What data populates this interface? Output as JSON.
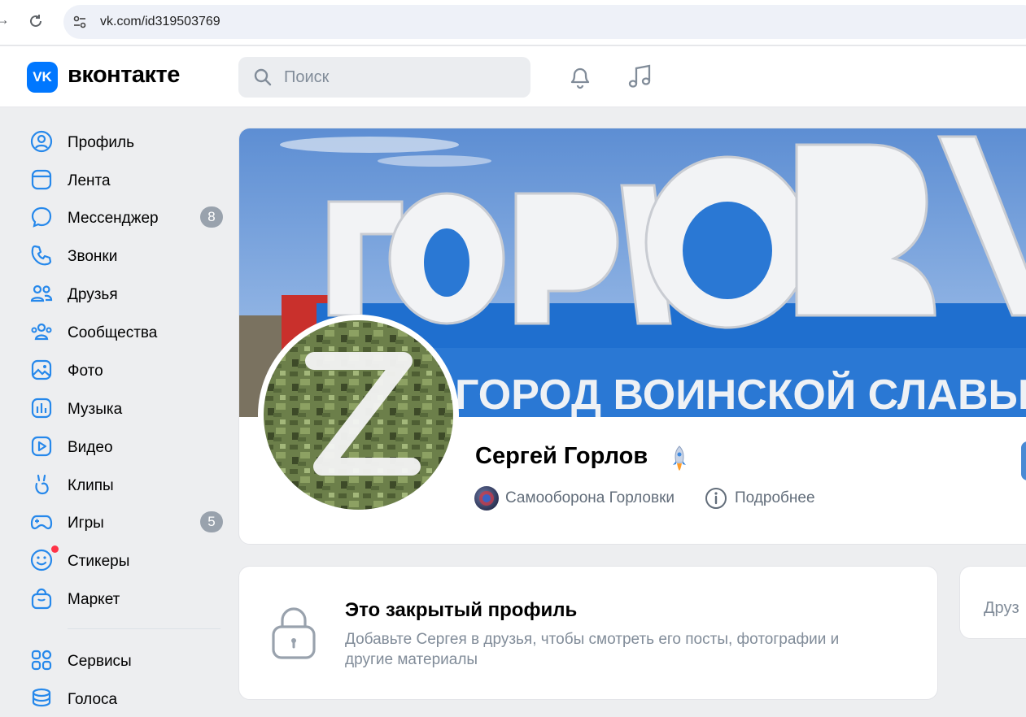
{
  "browser": {
    "url": "vk.com/id319503769"
  },
  "header": {
    "logo_mark": "VK",
    "logo_text": "вконтакте",
    "search_placeholder": "Поиск"
  },
  "sidebar": {
    "items": [
      {
        "label": "Профиль",
        "icon": "profile-icon"
      },
      {
        "label": "Лента",
        "icon": "feed-icon"
      },
      {
        "label": "Мессенджер",
        "icon": "messenger-icon",
        "badge": "8"
      },
      {
        "label": "Звонки",
        "icon": "phone-icon"
      },
      {
        "label": "Друзья",
        "icon": "friends-icon"
      },
      {
        "label": "Сообщества",
        "icon": "communities-icon"
      },
      {
        "label": "Фото",
        "icon": "photo-icon"
      },
      {
        "label": "Музыка",
        "icon": "music-icon"
      },
      {
        "label": "Видео",
        "icon": "video-icon"
      },
      {
        "label": "Клипы",
        "icon": "clips-icon"
      },
      {
        "label": "Игры",
        "icon": "games-icon",
        "badge": "5"
      },
      {
        "label": "Стикеры",
        "icon": "stickers-icon"
      },
      {
        "label": "Маркет",
        "icon": "market-icon"
      },
      {
        "label": "Сервисы",
        "icon": "services-icon"
      },
      {
        "label": "Голоса",
        "icon": "votes-icon"
      }
    ]
  },
  "profile": {
    "cover_sign_top": "ГОРЛОВКА",
    "cover_sign_bottom": "ГОРОД ВОИНСКОЙ СЛАВЫ",
    "name": "Сергей Горлов",
    "group": "Самооборона Горловки",
    "more": "Подробнее"
  },
  "closed_profile": {
    "title": "Это закрытый профиль",
    "text": "Добавьте Сергея в друзья, чтобы смотреть его посты, фотографии и другие материалы"
  },
  "friends_card": {
    "title_partial": "Друз"
  },
  "colors": {
    "accent": "#0077ff",
    "badge": "#99a2ad",
    "background": "#edeef0"
  }
}
